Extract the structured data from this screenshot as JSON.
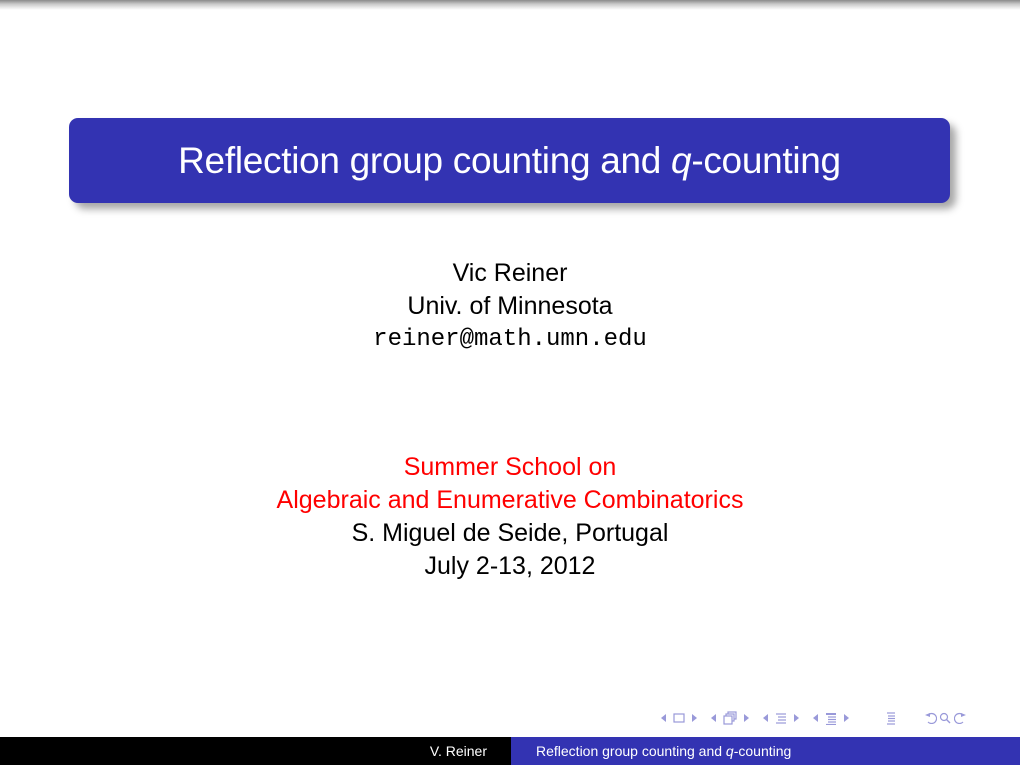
{
  "slide": {
    "title": {
      "prefix": "Reflection group counting and ",
      "italic": "q",
      "suffix": "-counting"
    },
    "author": {
      "name": "Vic Reiner",
      "affiliation": "Univ. of Minnesota",
      "email": "reiner@math.umn.edu"
    },
    "event": {
      "line1": "Summer School on",
      "line2": "Algebraic and Enumerative Combinatorics",
      "location": "S. Miguel de Seide, Portugal",
      "dates": "July 2-13, 2012"
    },
    "colors": {
      "accent": "#3333b2",
      "event_text": "#ff0000",
      "nav_icons": "#9999d9"
    }
  },
  "navigation": {
    "icons": [
      "prev-slide-arrow-icon",
      "slide-icon",
      "next-slide-arrow-icon",
      "prev-frame-arrow-icon",
      "frame-icon",
      "next-frame-arrow-icon",
      "prev-subsection-arrow-icon",
      "subsection-icon",
      "next-subsection-arrow-icon",
      "prev-section-arrow-icon",
      "section-icon",
      "next-section-arrow-icon",
      "outline-icon",
      "back-icon",
      "search-icon",
      "forward-icon"
    ]
  },
  "footer": {
    "author": "V. Reiner",
    "title_prefix": "Reflection group counting and ",
    "title_italic": "q",
    "title_suffix": "-counting"
  }
}
